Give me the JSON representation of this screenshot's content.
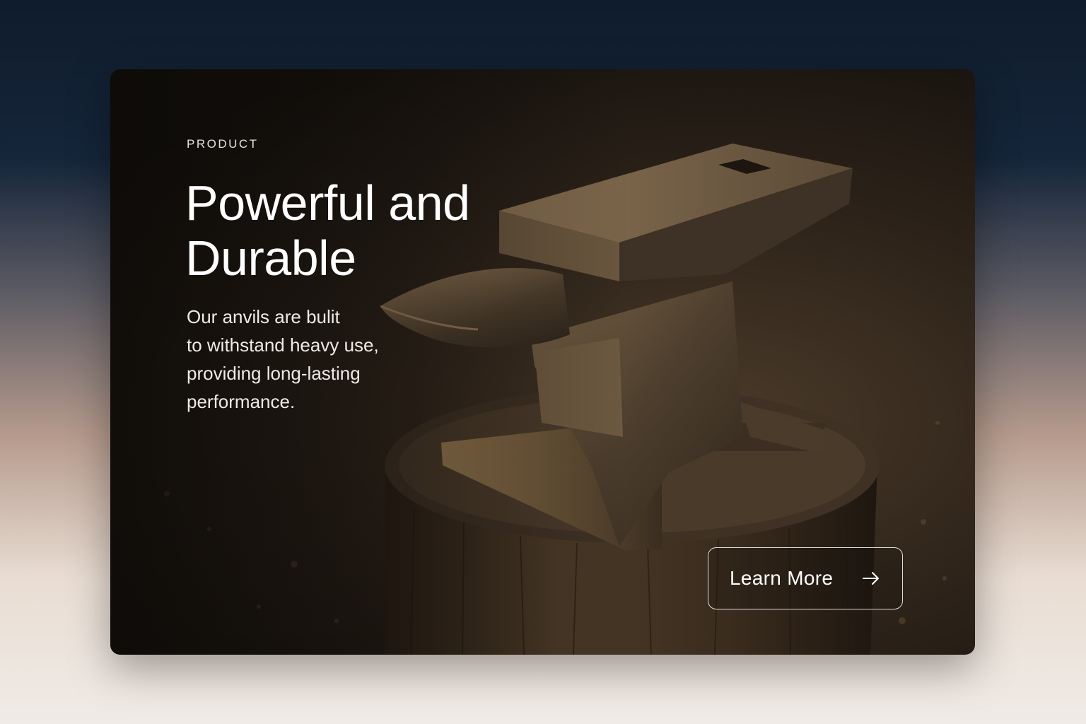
{
  "hero": {
    "eyebrow": "PRODUCT",
    "headline_lines": [
      "Powerful and",
      "Durable"
    ],
    "description_lines": [
      "Our anvils are bulit",
      "to withstand heavy use,",
      "providing long-lasting",
      "performance."
    ],
    "cta_label": "Learn More",
    "cta_icon": "arrow-right-icon",
    "image_subject": "anvil-on-tree-stump"
  },
  "colors": {
    "page_top": "#0f1c2c",
    "page_bottom": "#f0ebe6",
    "card_bg": "#2c2219",
    "text": "#ffffff",
    "anvil_metal": "#5a4a37",
    "stump_wood": "#3d2e20"
  }
}
